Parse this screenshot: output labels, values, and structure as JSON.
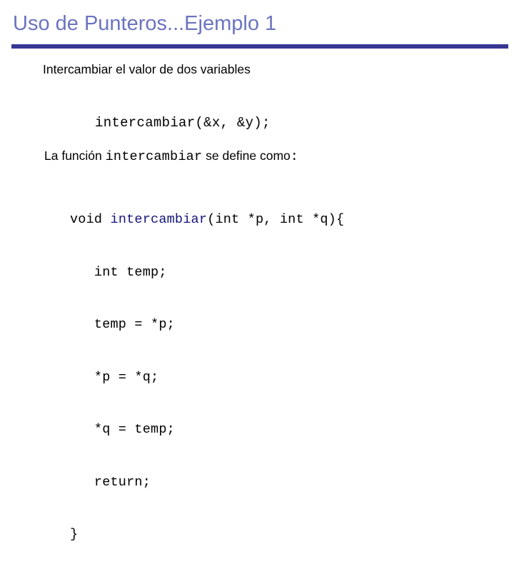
{
  "slide": {
    "title": "Uso de Punteros...Ejemplo 1",
    "accent_title_color": "#6C74C0",
    "accent_rule_color": "#373795",
    "background_color": "#FFFFFF",
    "body_text_color": "#000000",
    "code_highlight_color": "#14147A",
    "bullet": "Intercambiar el valor de dos variables",
    "call_example": "intercambiar(&x, &y);",
    "define_sentence": {
      "prefix": "La función ",
      "function_name": "intercambiar",
      "suffix": " se define como",
      "colon": ":"
    },
    "code": {
      "signature": {
        "before": "void ",
        "name": "intercambiar",
        "after": "(int *p, int *q){"
      },
      "body_lines": [
        "   int temp;",
        "   temp = *p;",
        "   *p = *q;",
        "   *q = temp;",
        "   return;",
        "}"
      ]
    }
  }
}
